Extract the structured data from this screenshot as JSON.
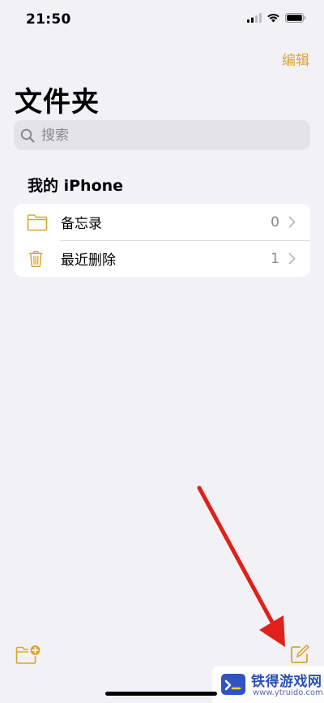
{
  "status_bar": {
    "time": "21:50",
    "signal_icon": "cellular-signal-icon",
    "wifi_icon": "wifi-icon",
    "battery_icon": "battery-icon"
  },
  "header": {
    "edit_label": "编辑",
    "title": "文件夹"
  },
  "search": {
    "placeholder": "搜索",
    "icon": "magnifying-glass-icon"
  },
  "section": {
    "title": "我的 iPhone"
  },
  "folders": [
    {
      "label": "备忘录",
      "count": "0",
      "icon": "folder-icon"
    },
    {
      "label": "最近删除",
      "count": "1",
      "icon": "trash-icon"
    }
  ],
  "toolbar": {
    "new_folder_icon": "new-folder-icon",
    "compose_icon": "compose-icon"
  },
  "watermark": {
    "title": "铁得游戏网",
    "url": "www.ytruido.com"
  },
  "colors": {
    "accent": "#d9a62e",
    "background": "#f2f1f6",
    "annotation_arrow": "#e0201b"
  }
}
